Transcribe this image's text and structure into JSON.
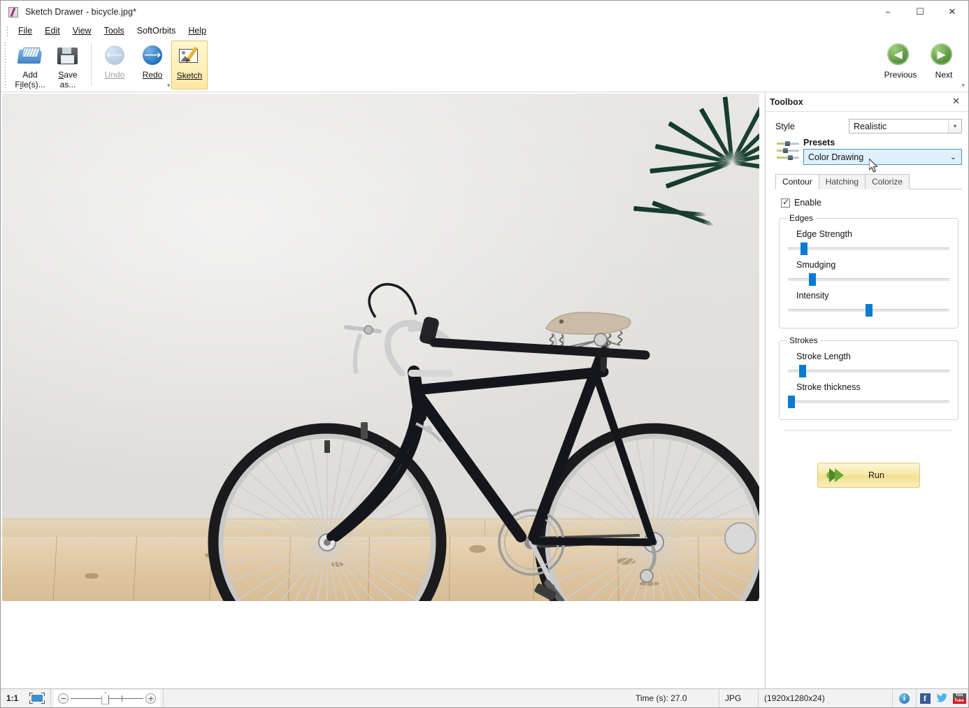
{
  "window": {
    "title": "Sketch Drawer - bicycle.jpg*",
    "app_icon": "sketch-app-icon",
    "minimize": "–",
    "maximize": "☐",
    "close": "✕"
  },
  "menu": {
    "items": [
      {
        "label": "File",
        "accel": "F"
      },
      {
        "label": "Edit",
        "accel": "E"
      },
      {
        "label": "View",
        "accel": "V"
      },
      {
        "label": "Tools",
        "accel": "T"
      },
      {
        "label": "SoftOrbits",
        "accel": ""
      },
      {
        "label": "Help",
        "accel": "H"
      }
    ]
  },
  "toolbar": {
    "add_files": {
      "line1": "Add",
      "line2": "File(s)...",
      "icon": "open-folder-icon"
    },
    "save_as": {
      "line1": "Save",
      "line2": "as...",
      "icon": "floppy-disk-icon"
    },
    "undo": {
      "label": "Undo",
      "icon": "undo-arrow-icon",
      "enabled": false
    },
    "redo": {
      "label": "Redo",
      "icon": "redo-arrow-icon",
      "enabled": true
    },
    "sketch": {
      "label": "Sketch",
      "icon": "sketch-picture-pencil-icon",
      "active": true
    },
    "previous": {
      "label": "Previous",
      "icon": "previous-green-arrow-icon"
    },
    "next": {
      "label": "Next",
      "icon": "next-green-arrow-icon"
    },
    "expand_glyph": "▾"
  },
  "toolbox": {
    "title": "Toolbox",
    "close_glyph": "✕",
    "style": {
      "label": "Style",
      "value": "Realistic",
      "arrow_glyph": "▾"
    },
    "presets": {
      "icon": "sliders-presets-icon",
      "label": "Presets",
      "value": "Color Drawing",
      "chevron_glyph": "⌄"
    },
    "tabs": [
      {
        "label": "Contour",
        "active": true
      },
      {
        "label": "Hatching",
        "active": false
      },
      {
        "label": "Colorize",
        "active": false
      }
    ],
    "enable": {
      "label": "Enable",
      "checked": true
    },
    "groups": [
      {
        "title": "Edges",
        "sliders": [
          {
            "label": "Edge Strength",
            "position_pct": 8
          },
          {
            "label": "Smudging",
            "position_pct": 13
          },
          {
            "label": "Intensity",
            "position_pct": 48
          }
        ]
      },
      {
        "title": "Strokes",
        "sliders": [
          {
            "label": "Stroke Length",
            "position_pct": 7
          },
          {
            "label": "Stroke thickness",
            "position_pct": 0
          }
        ]
      }
    ],
    "run": {
      "label": "Run",
      "icon": "green-double-arrow-icon"
    }
  },
  "canvas": {
    "image_name": "bicycle.jpg",
    "description": "photo-of-black-road-bicycle-against-light-wall-on-wooden-floor"
  },
  "statusbar": {
    "zoom_ratio": "1:1",
    "fit_icon": "fit-to-window-icon",
    "zoom_out_glyph": "−",
    "zoom_in_glyph": "+",
    "time": "Time (s): 27.0",
    "format": "JPG",
    "dimensions": "(1920x1280x24)",
    "info_glyph": "i",
    "facebook": "f",
    "twitter": "🐦",
    "youtube_line1": "You",
    "youtube_line2": "Tube"
  },
  "colors": {
    "accent_blue": "#0a7bd4",
    "highlight_yellow": "#f6e9a8",
    "tab_active": "#ffffff",
    "panel_bg": "#ffffff",
    "selection_blue": "#dff0fb"
  }
}
